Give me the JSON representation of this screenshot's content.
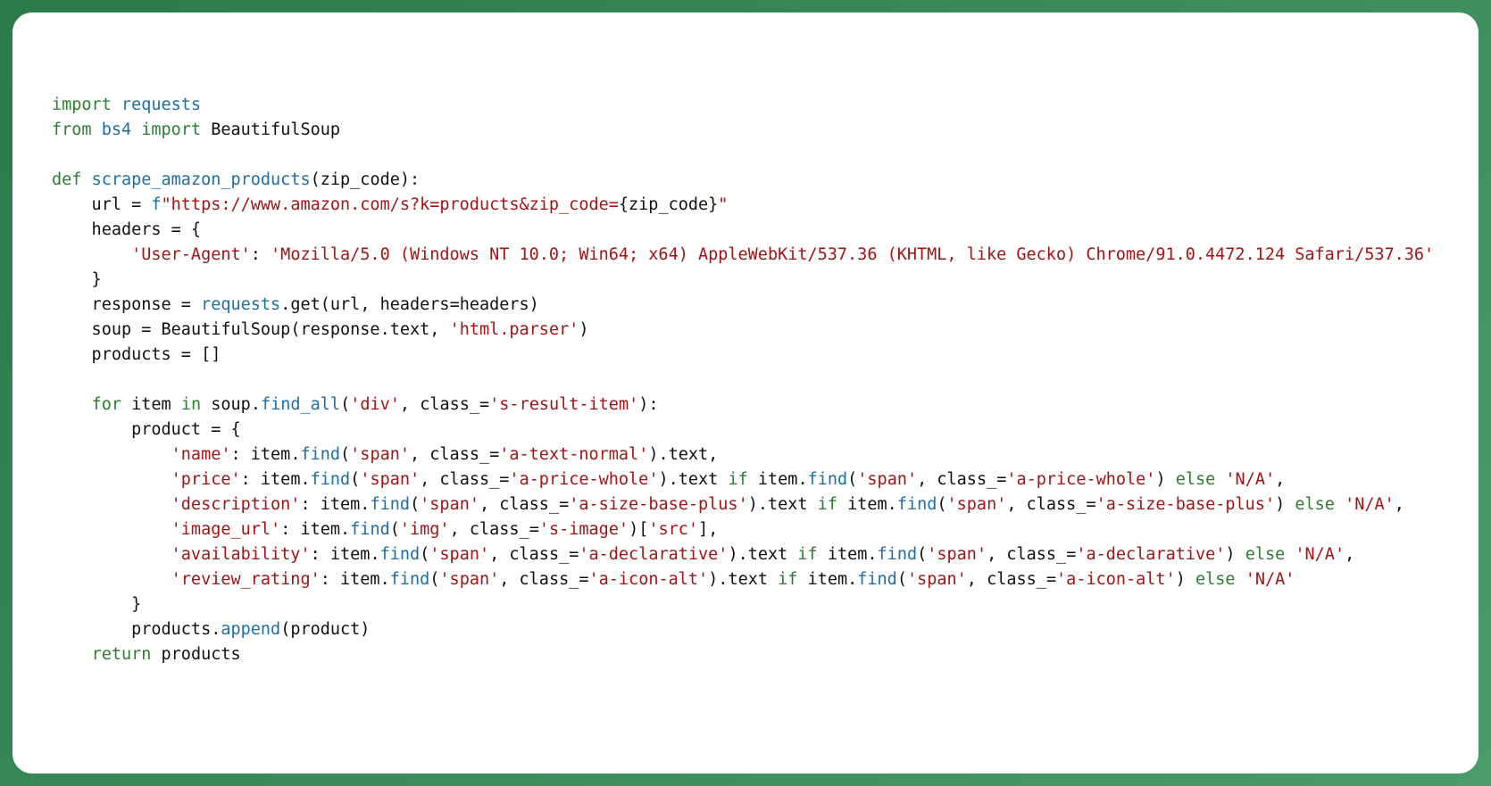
{
  "code": {
    "language": "python",
    "syntax_colors": {
      "keyword": "#2e7d32",
      "module_or_call": "#1e6fa3",
      "string": "#a31515",
      "default": "#1a1a1a"
    },
    "tokens": [
      [
        [
          "kw",
          "import"
        ],
        [
          "op",
          " "
        ],
        [
          "mod",
          "requests"
        ]
      ],
      [
        [
          "kw",
          "from"
        ],
        [
          "op",
          " "
        ],
        [
          "mod",
          "bs4"
        ],
        [
          "op",
          " "
        ],
        [
          "kw",
          "import"
        ],
        [
          "op",
          " "
        ],
        [
          "cls",
          "BeautifulSoup"
        ]
      ],
      [
        [
          "op",
          ""
        ]
      ],
      [
        [
          "kw",
          "def"
        ],
        [
          "op",
          " "
        ],
        [
          "fn",
          "scrape_amazon_products"
        ],
        [
          "par",
          "("
        ],
        [
          "var",
          "zip_code"
        ],
        [
          "par",
          ")"
        ],
        [
          "op",
          ":"
        ]
      ],
      [
        [
          "op",
          "    url "
        ],
        [
          "op",
          "="
        ],
        [
          "op",
          " "
        ],
        [
          "strf",
          "f"
        ],
        [
          "str",
          "\"https://www.amazon.com/s?k=products&zip_code="
        ],
        [
          "op",
          "{"
        ],
        [
          "var",
          "zip_code"
        ],
        [
          "op",
          "}"
        ],
        [
          "str",
          "\""
        ]
      ],
      [
        [
          "op",
          "    headers "
        ],
        [
          "op",
          "="
        ],
        [
          "op",
          " {"
        ]
      ],
      [
        [
          "op",
          "        "
        ],
        [
          "str",
          "'User-Agent'"
        ],
        [
          "op",
          ": "
        ],
        [
          "str",
          "'Mozilla/5.0 (Windows NT 10.0; Win64; x64) AppleWebKit/537.36 (KHTML, like Gecko) Chrome/91.0.4472.124 Safari/537.36'"
        ]
      ],
      [
        [
          "op",
          "    }"
        ]
      ],
      [
        [
          "op",
          "    response "
        ],
        [
          "op",
          "="
        ],
        [
          "op",
          " "
        ],
        [
          "mod",
          "requests"
        ],
        [
          "op",
          "."
        ],
        [
          "attr",
          "get"
        ],
        [
          "par",
          "("
        ],
        [
          "var",
          "url"
        ],
        [
          "op",
          ", "
        ],
        [
          "var",
          "headers"
        ],
        [
          "op",
          "="
        ],
        [
          "var",
          "headers"
        ],
        [
          "par",
          ")"
        ]
      ],
      [
        [
          "op",
          "    soup "
        ],
        [
          "op",
          "="
        ],
        [
          "op",
          " "
        ],
        [
          "cls",
          "BeautifulSoup"
        ],
        [
          "par",
          "("
        ],
        [
          "var",
          "response"
        ],
        [
          "op",
          "."
        ],
        [
          "attr",
          "text"
        ],
        [
          "op",
          ", "
        ],
        [
          "str",
          "'html.parser'"
        ],
        [
          "par",
          ")"
        ]
      ],
      [
        [
          "op",
          "    products "
        ],
        [
          "op",
          "="
        ],
        [
          "op",
          " []"
        ]
      ],
      [
        [
          "op",
          ""
        ]
      ],
      [
        [
          "op",
          "    "
        ],
        [
          "kw",
          "for"
        ],
        [
          "op",
          " "
        ],
        [
          "var",
          "item"
        ],
        [
          "op",
          " "
        ],
        [
          "kw",
          "in"
        ],
        [
          "op",
          " "
        ],
        [
          "var",
          "soup"
        ],
        [
          "op",
          "."
        ],
        [
          "call",
          "find_all"
        ],
        [
          "par",
          "("
        ],
        [
          "str",
          "'div'"
        ],
        [
          "op",
          ", "
        ],
        [
          "var",
          "class_"
        ],
        [
          "op",
          "="
        ],
        [
          "str",
          "'s-result-item'"
        ],
        [
          "par",
          ")"
        ],
        [
          "op",
          ":"
        ]
      ],
      [
        [
          "op",
          "        product "
        ],
        [
          "op",
          "="
        ],
        [
          "op",
          " {"
        ]
      ],
      [
        [
          "op",
          "            "
        ],
        [
          "str",
          "'name'"
        ],
        [
          "op",
          ": "
        ],
        [
          "var",
          "item"
        ],
        [
          "op",
          "."
        ],
        [
          "call",
          "find"
        ],
        [
          "par",
          "("
        ],
        [
          "str",
          "'span'"
        ],
        [
          "op",
          ", "
        ],
        [
          "var",
          "class_"
        ],
        [
          "op",
          "="
        ],
        [
          "str",
          "'a-text-normal'"
        ],
        [
          "par",
          ")"
        ],
        [
          "op",
          "."
        ],
        [
          "attr",
          "text"
        ],
        [
          "op",
          ","
        ]
      ],
      [
        [
          "op",
          "            "
        ],
        [
          "str",
          "'price'"
        ],
        [
          "op",
          ": "
        ],
        [
          "var",
          "item"
        ],
        [
          "op",
          "."
        ],
        [
          "call",
          "find"
        ],
        [
          "par",
          "("
        ],
        [
          "str",
          "'span'"
        ],
        [
          "op",
          ", "
        ],
        [
          "var",
          "class_"
        ],
        [
          "op",
          "="
        ],
        [
          "str",
          "'a-price-whole'"
        ],
        [
          "par",
          ")"
        ],
        [
          "op",
          "."
        ],
        [
          "attr",
          "text"
        ],
        [
          "op",
          " "
        ],
        [
          "kw",
          "if"
        ],
        [
          "op",
          " "
        ],
        [
          "var",
          "item"
        ],
        [
          "op",
          "."
        ],
        [
          "call",
          "find"
        ],
        [
          "par",
          "("
        ],
        [
          "str",
          "'span'"
        ],
        [
          "op",
          ", "
        ],
        [
          "var",
          "class_"
        ],
        [
          "op",
          "="
        ],
        [
          "str",
          "'a-price-whole'"
        ],
        [
          "par",
          ")"
        ],
        [
          "op",
          " "
        ],
        [
          "kw",
          "else"
        ],
        [
          "op",
          " "
        ],
        [
          "str",
          "'N/A'"
        ],
        [
          "op",
          ","
        ]
      ],
      [
        [
          "op",
          "            "
        ],
        [
          "str",
          "'description'"
        ],
        [
          "op",
          ": "
        ],
        [
          "var",
          "item"
        ],
        [
          "op",
          "."
        ],
        [
          "call",
          "find"
        ],
        [
          "par",
          "("
        ],
        [
          "str",
          "'span'"
        ],
        [
          "op",
          ", "
        ],
        [
          "var",
          "class_"
        ],
        [
          "op",
          "="
        ],
        [
          "str",
          "'a-size-base-plus'"
        ],
        [
          "par",
          ")"
        ],
        [
          "op",
          "."
        ],
        [
          "attr",
          "text"
        ],
        [
          "op",
          " "
        ],
        [
          "kw",
          "if"
        ],
        [
          "op",
          " "
        ],
        [
          "var",
          "item"
        ],
        [
          "op",
          "."
        ],
        [
          "call",
          "find"
        ],
        [
          "par",
          "("
        ],
        [
          "str",
          "'span'"
        ],
        [
          "op",
          ", "
        ],
        [
          "var",
          "class_"
        ],
        [
          "op",
          "="
        ],
        [
          "str",
          "'a-size-base-plus'"
        ],
        [
          "par",
          ")"
        ],
        [
          "op",
          " "
        ],
        [
          "kw",
          "else"
        ],
        [
          "op",
          " "
        ],
        [
          "str",
          "'N/A'"
        ],
        [
          "op",
          ","
        ]
      ],
      [
        [
          "op",
          "            "
        ],
        [
          "str",
          "'image_url'"
        ],
        [
          "op",
          ": "
        ],
        [
          "var",
          "item"
        ],
        [
          "op",
          "."
        ],
        [
          "call",
          "find"
        ],
        [
          "par",
          "("
        ],
        [
          "str",
          "'img'"
        ],
        [
          "op",
          ", "
        ],
        [
          "var",
          "class_"
        ],
        [
          "op",
          "="
        ],
        [
          "str",
          "'s-image'"
        ],
        [
          "par",
          ")"
        ],
        [
          "op",
          "["
        ],
        [
          "str",
          "'src'"
        ],
        [
          "op",
          "],"
        ]
      ],
      [
        [
          "op",
          "            "
        ],
        [
          "str",
          "'availability'"
        ],
        [
          "op",
          ": "
        ],
        [
          "var",
          "item"
        ],
        [
          "op",
          "."
        ],
        [
          "call",
          "find"
        ],
        [
          "par",
          "("
        ],
        [
          "str",
          "'span'"
        ],
        [
          "op",
          ", "
        ],
        [
          "var",
          "class_"
        ],
        [
          "op",
          "="
        ],
        [
          "str",
          "'a-declarative'"
        ],
        [
          "par",
          ")"
        ],
        [
          "op",
          "."
        ],
        [
          "attr",
          "text"
        ],
        [
          "op",
          " "
        ],
        [
          "kw",
          "if"
        ],
        [
          "op",
          " "
        ],
        [
          "var",
          "item"
        ],
        [
          "op",
          "."
        ],
        [
          "call",
          "find"
        ],
        [
          "par",
          "("
        ],
        [
          "str",
          "'span'"
        ],
        [
          "op",
          ", "
        ],
        [
          "var",
          "class_"
        ],
        [
          "op",
          "="
        ],
        [
          "str",
          "'a-declarative'"
        ],
        [
          "par",
          ")"
        ],
        [
          "op",
          " "
        ],
        [
          "kw",
          "else"
        ],
        [
          "op",
          " "
        ],
        [
          "str",
          "'N/A'"
        ],
        [
          "op",
          ","
        ]
      ],
      [
        [
          "op",
          "            "
        ],
        [
          "str",
          "'review_rating'"
        ],
        [
          "op",
          ": "
        ],
        [
          "var",
          "item"
        ],
        [
          "op",
          "."
        ],
        [
          "call",
          "find"
        ],
        [
          "par",
          "("
        ],
        [
          "str",
          "'span'"
        ],
        [
          "op",
          ", "
        ],
        [
          "var",
          "class_"
        ],
        [
          "op",
          "="
        ],
        [
          "str",
          "'a-icon-alt'"
        ],
        [
          "par",
          ")"
        ],
        [
          "op",
          "."
        ],
        [
          "attr",
          "text"
        ],
        [
          "op",
          " "
        ],
        [
          "kw",
          "if"
        ],
        [
          "op",
          " "
        ],
        [
          "var",
          "item"
        ],
        [
          "op",
          "."
        ],
        [
          "call",
          "find"
        ],
        [
          "par",
          "("
        ],
        [
          "str",
          "'span'"
        ],
        [
          "op",
          ", "
        ],
        [
          "var",
          "class_"
        ],
        [
          "op",
          "="
        ],
        [
          "str",
          "'a-icon-alt'"
        ],
        [
          "par",
          ")"
        ],
        [
          "op",
          " "
        ],
        [
          "kw",
          "else"
        ],
        [
          "op",
          " "
        ],
        [
          "str",
          "'N/A'"
        ]
      ],
      [
        [
          "op",
          "        }"
        ]
      ],
      [
        [
          "op",
          "        "
        ],
        [
          "var",
          "products"
        ],
        [
          "op",
          "."
        ],
        [
          "call",
          "append"
        ],
        [
          "par",
          "("
        ],
        [
          "var",
          "product"
        ],
        [
          "par",
          ")"
        ]
      ],
      [
        [
          "op",
          "    "
        ],
        [
          "kw",
          "return"
        ],
        [
          "op",
          " "
        ],
        [
          "var",
          "products"
        ]
      ]
    ]
  }
}
